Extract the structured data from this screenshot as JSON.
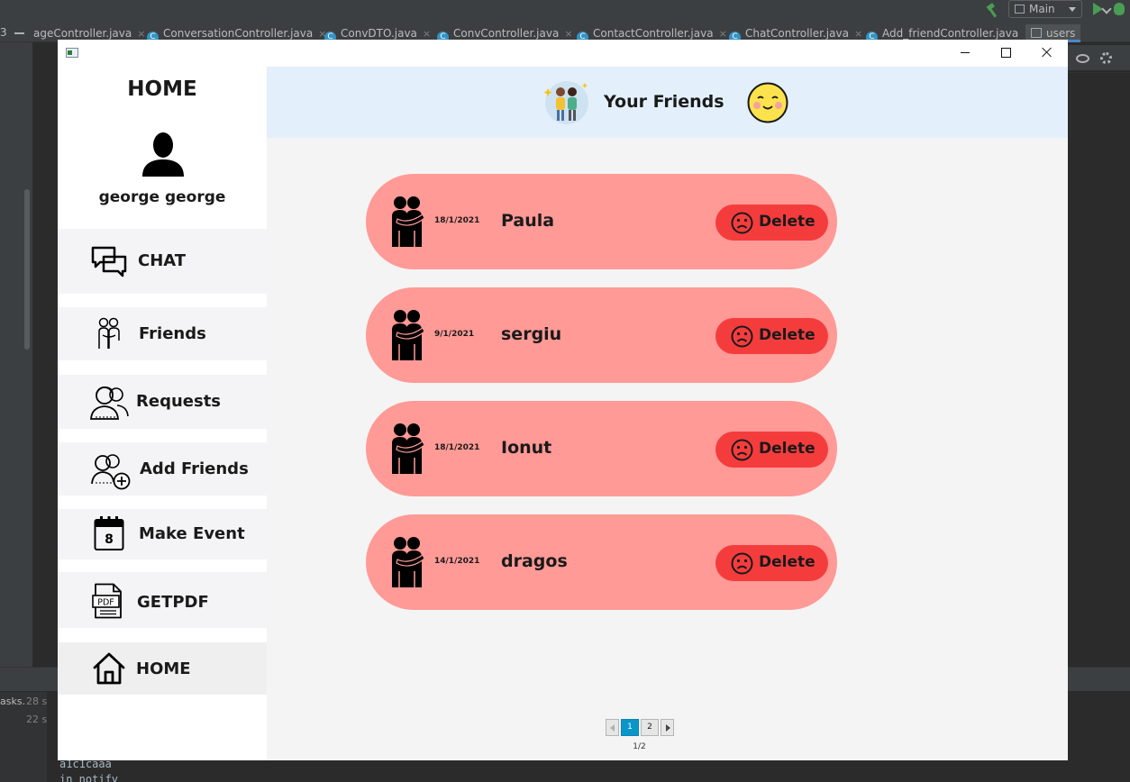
{
  "ide": {
    "run_config": "Main",
    "tab_left_count": "3",
    "tabs": [
      "ageController.java",
      "ConversationController.java",
      "ConvDTO.java",
      "ConvController.java",
      "ContactController.java",
      "ChatController.java",
      "Add_friendController.java",
      "users"
    ],
    "tab_close": "×",
    "tab_c": "C",
    "bottom": {
      "tasks_label": "asks.",
      "time1": "28 s",
      "time2": "22 s",
      "log1": "a1c1caaa",
      "log2": "in notify"
    }
  },
  "app": {
    "sidebar": {
      "title": "HOME",
      "user_name": "george george",
      "items": [
        {
          "label": "CHAT",
          "icon": "chat-icon"
        },
        {
          "label": "Friends",
          "icon": "friends-icon"
        },
        {
          "label": "Requests",
          "icon": "requests-icon"
        },
        {
          "label": "Add Friends",
          "icon": "add-friends-icon"
        },
        {
          "label": "Make Event",
          "icon": "calendar-icon"
        },
        {
          "label": "GETPDF",
          "icon": "pdf-icon"
        },
        {
          "label": "HOME",
          "icon": "home-icon"
        }
      ],
      "calendar_day": "8",
      "pdf_text": "PDF"
    },
    "header": {
      "title": "Your Friends",
      "bg_color": "#e3f0fb"
    },
    "friends": [
      {
        "name": "Paula",
        "date": "18/1/2021",
        "delete_label": "Delete"
      },
      {
        "name": "sergiu",
        "date": "9/1/2021",
        "delete_label": "Delete"
      },
      {
        "name": "Ionut",
        "date": "18/1/2021",
        "delete_label": "Delete"
      },
      {
        "name": "dragos",
        "date": "14/1/2021",
        "delete_label": "Delete"
      }
    ],
    "card_color": "#ff9a96",
    "delete_color": "#f53c3d",
    "pagination": {
      "pages": [
        "1",
        "2"
      ],
      "current": "1",
      "count_text": "1/2"
    }
  }
}
